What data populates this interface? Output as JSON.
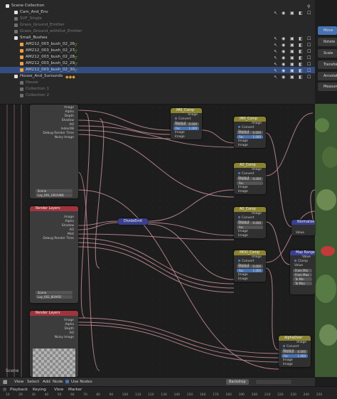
{
  "outliner": {
    "rows": [
      {
        "label": "Scene Collection",
        "dim": false
      },
      {
        "label": "Cam_And_Env",
        "dim": false
      },
      {
        "label": "SUF_Single",
        "dim": true
      },
      {
        "label": "Grass_Ground_Emitter",
        "dim": true
      },
      {
        "label": "Grass_Ground_withOut_Emitter",
        "dim": true
      },
      {
        "label": "Small_Bushes",
        "dim": false
      },
      {
        "label": "AM212_003_bush_02_26",
        "dim": false
      },
      {
        "label": "AM212_003_bush_02_27",
        "dim": false
      },
      {
        "label": "AM212_003_bush_02_28",
        "dim": false
      },
      {
        "label": "AM212_003_bush_02_29",
        "dim": false
      },
      {
        "label": "AM212_003_bush_02_30",
        "dim": false
      },
      {
        "label": "House_And_Surounds",
        "dim": false
      },
      {
        "label": "Hause",
        "dim": true
      },
      {
        "label": "Collection 1",
        "dim": true
      },
      {
        "label": "Collection 2",
        "dim": true
      }
    ]
  },
  "tools": [
    {
      "label": "Move",
      "active": true
    },
    {
      "label": "Rotate",
      "active": false
    },
    {
      "label": "Scale",
      "active": false
    },
    {
      "label": "Transform",
      "active": false
    },
    {
      "label": "Annotate",
      "active": false
    },
    {
      "label": "Measure",
      "active": false
    }
  ],
  "render_layer_1": {
    "passes": [
      "Image",
      "Alpha",
      "Depth",
      "Shadow",
      "AO",
      "IndexOB",
      "Debug Render Time",
      "Noisy Image"
    ],
    "scene": "Scene",
    "layer": "Lay_001_GROUND"
  },
  "render_layer_2": {
    "title": "Render Layers",
    "passes": [
      "Image",
      "Alpha",
      "Shadow",
      "AO",
      "Mist",
      "Debug Render Time"
    ],
    "scene": "Scene",
    "layer": "Lay_002_BOARD"
  },
  "render_layer_3": {
    "title": "Render Layers",
    "passes": [
      "Image",
      "Alpha",
      "Depth",
      "AO",
      "Noisy Image"
    ]
  },
  "mix_nodes": [
    {
      "title": "IM0_Comp",
      "out": "Image",
      "opt": "Convert Premul",
      "premul": "Premul",
      "premul_val": "0.000",
      "fac": "Fac",
      "fac_val": "1.000",
      "in1": "Image",
      "in2": "Image"
    },
    {
      "title": "IM0_Comp",
      "out": "Image",
      "opt": "Convert Premul",
      "premul": "Premul",
      "premul_val": "0.000",
      "fac": "Fac",
      "fac_val": "1.000",
      "in1": "Image",
      "in2": "Image"
    },
    {
      "title": "A0_Comp",
      "out": "Image",
      "opt": "Convert Premul",
      "premul": "Premul",
      "premul_val": "0.000",
      "fac": "Fac",
      "fac_val": "",
      "in1": "Image",
      "in2": "Image"
    },
    {
      "title": "A0_Comp",
      "out": "Image",
      "opt": "Convert Premul",
      "premul": "Premul",
      "premul_val": "0.000",
      "fac": "Fac",
      "fac_val": "",
      "in1": "Image",
      "in2": "Image"
    },
    {
      "title": "MDO_Comp",
      "out": "Image",
      "opt": "Convert Premul",
      "premul": "Premul",
      "premul_val": "0.000",
      "fac": "Fac",
      "fac_val": "1.000",
      "in1": "Image",
      "in2": "Image"
    },
    {
      "title": "AlphaOver",
      "out": "Image",
      "opt": "Convert Premul",
      "premul": "Premul",
      "premul_val": "0.000",
      "fac": "Fac",
      "fac_val": "1.000",
      "in1": "Image",
      "in2": "Image"
    }
  ],
  "divide_node": {
    "title": "DivideEmit"
  },
  "normalize_node": {
    "title": "Normalize",
    "in": "Value"
  },
  "map_range": {
    "title": "Map Range",
    "out": "Value",
    "opt": "Clamp",
    "rows": [
      "Value",
      "From Min",
      "From Max",
      "To Min",
      "To Max"
    ]
  },
  "node_header": {
    "menus": [
      "View",
      "Select",
      "Add",
      "Node"
    ],
    "use_nodes": "Use Nodes",
    "backdrop": "Backdrop"
  },
  "timeline": {
    "menus": [
      "Playback",
      "Keying",
      "View",
      "Marker"
    ],
    "numbers": [
      "10",
      "20",
      "30",
      "40",
      "50",
      "60",
      "70",
      "80",
      "90",
      "100",
      "110",
      "120",
      "130",
      "140",
      "150",
      "160",
      "170",
      "180",
      "190",
      "200",
      "210",
      "220",
      "230",
      "240",
      "250"
    ]
  },
  "left_label": "Scene",
  "colors": {
    "accent": "#4772b3",
    "node_yellow": "#8a8330",
    "node_red": "#a0343c",
    "wire": "#c78f9b"
  }
}
